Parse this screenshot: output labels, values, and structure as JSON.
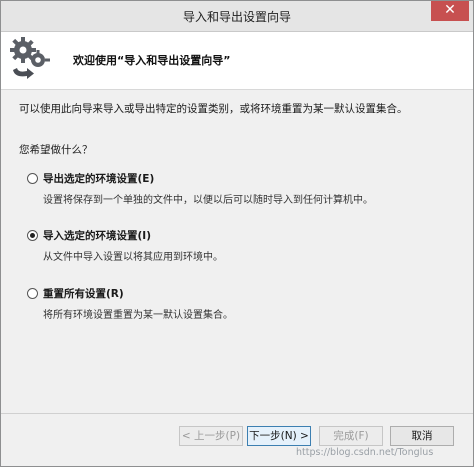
{
  "window": {
    "title": "导入和导出设置向导",
    "close_glyph": "✕"
  },
  "header": {
    "icon": "gears-arrow-icon",
    "text": "欢迎使用“导入和导出设置向导”"
  },
  "body": {
    "intro": "可以使用此向导来导入或导出特定的设置类别，或将环境重置为某一默认设置集合。",
    "question": "您希望做什么？",
    "options": [
      {
        "label": "导出选定的环境设置(E)",
        "description": "设置将保存到一个单独的文件中，以便以后可以随时导入到任何计算机中。",
        "selected": false
      },
      {
        "label": "导入选定的环境设置(I)",
        "description": "从文件中导入设置以将其应用到环境中。",
        "selected": true
      },
      {
        "label": "重置所有设置(R)",
        "description": "将所有环境设置重置为某一默认设置集合。",
        "selected": false
      }
    ]
  },
  "buttons": {
    "prev": "< 上一步(P)",
    "next": "下一步(N) >",
    "finish": "完成(F)",
    "cancel": "取消"
  },
  "watermark": "https://blog.csdn.net/Tonglus"
}
